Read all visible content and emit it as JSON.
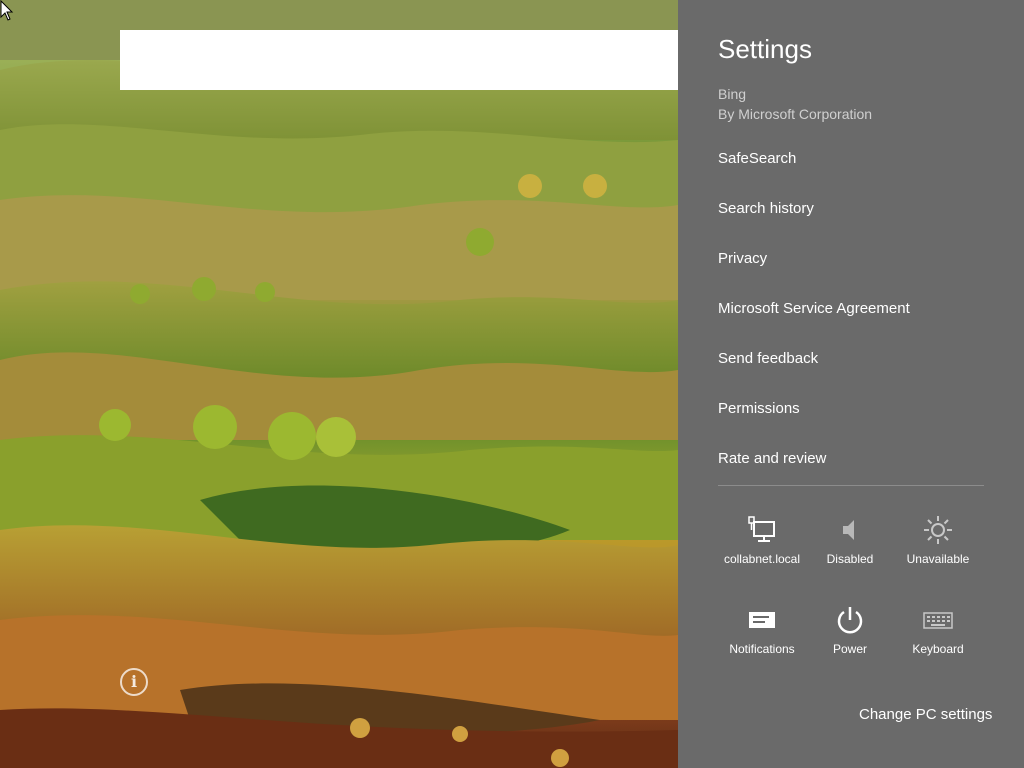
{
  "search": {
    "value": "",
    "placeholder": ""
  },
  "info_button": {
    "glyph": "i"
  },
  "charm": {
    "title": "Settings",
    "app_name": "Bing",
    "app_publisher": "By Microsoft Corporation",
    "menu_items": [
      "SafeSearch",
      "Search history",
      "Privacy",
      "Microsoft Service Agreement",
      "Send feedback",
      "Permissions",
      "Rate and review"
    ],
    "quick_tiles": [
      {
        "label": "collabnet.local",
        "icon": "network-icon"
      },
      {
        "label": "Disabled",
        "icon": "volume-icon"
      },
      {
        "label": "Unavailable",
        "icon": "brightness-icon"
      },
      {
        "label": "Notifications",
        "icon": "notifications-icon"
      },
      {
        "label": "Power",
        "icon": "power-icon"
      },
      {
        "label": "Keyboard",
        "icon": "keyboard-icon"
      }
    ],
    "change_pc_settings": "Change PC settings"
  },
  "colors": {
    "charm_background": "#6a6a6a",
    "text": "#ffffff",
    "subtext": "#d0d0d0"
  }
}
